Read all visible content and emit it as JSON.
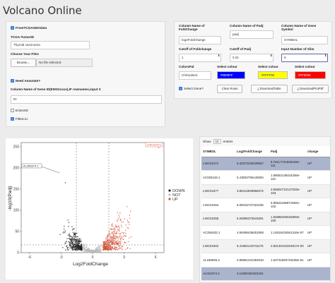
{
  "app": {
    "title": "Volcano Online"
  },
  "left": {
    "from_tcga_label": "FromTCGAGEOdata",
    "tcga_tumor_label": "TCGA-TumorID",
    "tcga_tumor_value": "Thyroid carcinoma",
    "choose_files_label": "Choose Your Files",
    "browse_label": "Browse...",
    "no_file_label": "No file selected",
    "need_annotate_label": "Need Annotate?",
    "column_name_gene_label": "Column Name of Gene ID(ENSGxxxx),IF rownames,input X",
    "column_name_gene_value": "ID",
    "entrezid_label": "EntrezID",
    "filterlnc_label": "FilterLnc"
  },
  "right": {
    "fc_col_label": "Column Name of FoldChange",
    "fc_col_value": "log2FoldChange",
    "padj_col_label": "Column Name of Padj",
    "padj_col_value": "padj",
    "gene_symbol_label": "Column Name of Gene Symbol",
    "gene_symbol_value": "SYMBOL",
    "cutoff_fc_label": "Cutoff of Foldchange",
    "cutoff_fc_value": "1",
    "cutoff_padj_label": "Cutoff of Padj",
    "cutoff_padj_value": "0.01",
    "xlim_label": "Input Number of Xlim",
    "xlim_value": "6",
    "colorspal_label": "ColorsPal",
    "colorspal_value": "ChrisLiBe2",
    "select_colour_1_label": "Select colour",
    "select_colour_1_value": "#0000FF",
    "select_colour_2_label": "Select colour",
    "select_colour_2_value": "#FFFF00",
    "select_colour_3_label": "Select colour",
    "select_colour_3_value": "#FF0000",
    "select_gene_label": "Select Gene?",
    "clear_rows_label": "Clear Rows",
    "download_table_label": "DownloadTable",
    "download_plot_label": "DownloadPlotPdf"
  },
  "plot": {
    "annotation_1": "AL356074.1",
    "annotation_2": "LINC00271",
    "legend": [
      "DOWN",
      "NOT",
      "UP"
    ],
    "legend_colors": [
      "#222222",
      "#bbbbbb",
      "#d6543a"
    ],
    "xlabel": "Log2FoldChange",
    "ylabel": "-log10(Padj)",
    "x_ticks": [
      "-6",
      "-3",
      "0",
      "3",
      "6"
    ],
    "y_ticks": [
      "0",
      "50",
      "100",
      "150",
      "200",
      "250"
    ]
  },
  "table": {
    "show_label": "Show",
    "show_value": "10",
    "entries_label": "entries",
    "headers": [
      "SYMBOL",
      "Log2FoldChange",
      "Padj",
      "change"
    ],
    "rows": [
      {
        "symbol": "LINC02471",
        "fc": "6.33373236239587",
        "padj": "8.75117741828169e-111",
        "change": "UP"
      },
      {
        "symbol": "AC025418.1",
        "fc": "5.43832756149284",
        "padj": "1.98053148424256e-110",
        "change": "UP"
      },
      {
        "symbol": "LINC01877",
        "fc": "3.86413929968472",
        "padj": "3.96802710147203e-103",
        "change": "UP"
      },
      {
        "symbol": "LINC02454",
        "fc": "6.08315737322235",
        "padj": "5.85921196871582e-102",
        "change": "UP"
      },
      {
        "symbol": "LINC02255",
        "fc": "6.28386373543291",
        "padj": "1.84885493634893e-100",
        "change": "UP"
      },
      {
        "symbol": "AC254633.1",
        "fc": "4.58498438451908",
        "padj": "1.14815434941316e-97",
        "change": "UP"
      },
      {
        "symbol": "LINC01602",
        "fc": "5.41984143741176",
        "padj": "2.82130101844817e-93",
        "change": "UP"
      },
      {
        "symbol": "AL158835.3",
        "fc": "2.85861231364818",
        "padj": "1.62731893718196e-91",
        "change": "UP"
      },
      {
        "symbol": "AL034374.2",
        "fc": "3.11980420483194",
        "padj": "",
        "change": ""
      }
    ]
  }
}
